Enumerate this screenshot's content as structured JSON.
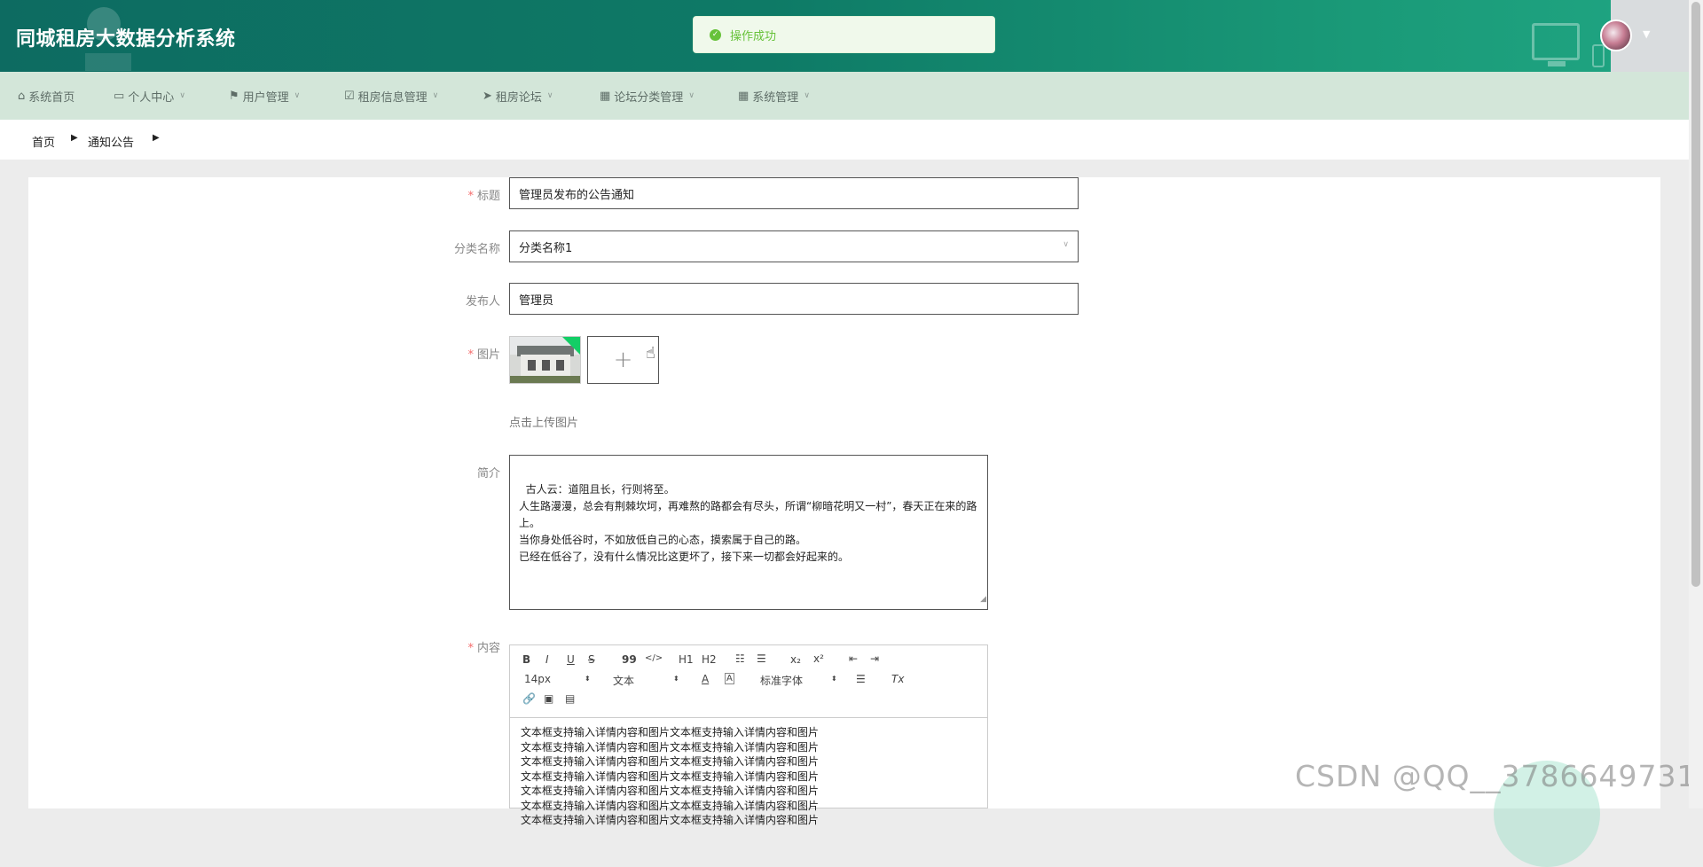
{
  "header": {
    "app_title": "同城租房大数据分析系统",
    "toast_text": "操作成功",
    "toast_icon": "check-circle-icon"
  },
  "nav": {
    "items": [
      {
        "label": "系统首页",
        "icon": "home-icon"
      },
      {
        "label": "个人中心",
        "icon": "card-icon"
      },
      {
        "label": "用户管理",
        "icon": "flag-icon"
      },
      {
        "label": "租房信息管理",
        "icon": "check-square-icon"
      },
      {
        "label": "租房论坛",
        "icon": "send-icon"
      },
      {
        "label": "论坛分类管理",
        "icon": "grid-icon"
      },
      {
        "label": "系统管理",
        "icon": "grid-icon"
      }
    ]
  },
  "breadcrumb": {
    "home": "首页",
    "current": "通知公告"
  },
  "form": {
    "title_label": "标题",
    "title_value": "管理员发布的公告通知",
    "category_label": "分类名称",
    "category_value": "分类名称1",
    "publisher_label": "发布人",
    "publisher_value": "管理员",
    "image_label": "图片",
    "upload_hint": "点击上传图片",
    "intro_label": "简介",
    "intro_value": "古人云：道阻且长，行则将至。\n人生路漫漫，总会有荆棘坎坷，再难熬的路都会有尽头，所谓“柳暗花明又一村”，春天正在来的路上。\n当你身处低谷时，不如放低自己的心态，摸索属于自己的路。\n已经在低谷了，没有什么情况比这更坏了，接下来一切都会好起来的。",
    "content_label": "内容",
    "content_lines": [
      "文本框支持输入详情内容和图片文本框支持输入详情内容和图片",
      "文本框支持输入详情内容和图片文本框支持输入详情内容和图片",
      "文本框支持输入详情内容和图片文本框支持输入详情内容和图片",
      "文本框支持输入详情内容和图片文本框支持输入详情内容和图片",
      "文本框支持输入详情内容和图片文本框支持输入详情内容和图片",
      "文本框支持输入详情内容和图片文本框支持输入详情内容和图片",
      "文本框支持输入详情内容和图片文本框支持输入详情内容和图片"
    ]
  },
  "editor_toolbar": {
    "bold": "B",
    "italic": "I",
    "underline": "U",
    "strike": "S",
    "quote": "99",
    "code": "</>",
    "h1": "H1",
    "h2": "H2",
    "sub": "x₂",
    "sup": "x²",
    "size_value": "14px",
    "para_value": "文本",
    "font_value": "标准字体",
    "clear": "Tx"
  },
  "watermark": "CSDN @QQ__3786649731",
  "colors": {
    "header_bg": "#0e7a66",
    "nav_bg": "#d3e6d9",
    "success": "#67c23a",
    "required": "#f56c6c"
  }
}
